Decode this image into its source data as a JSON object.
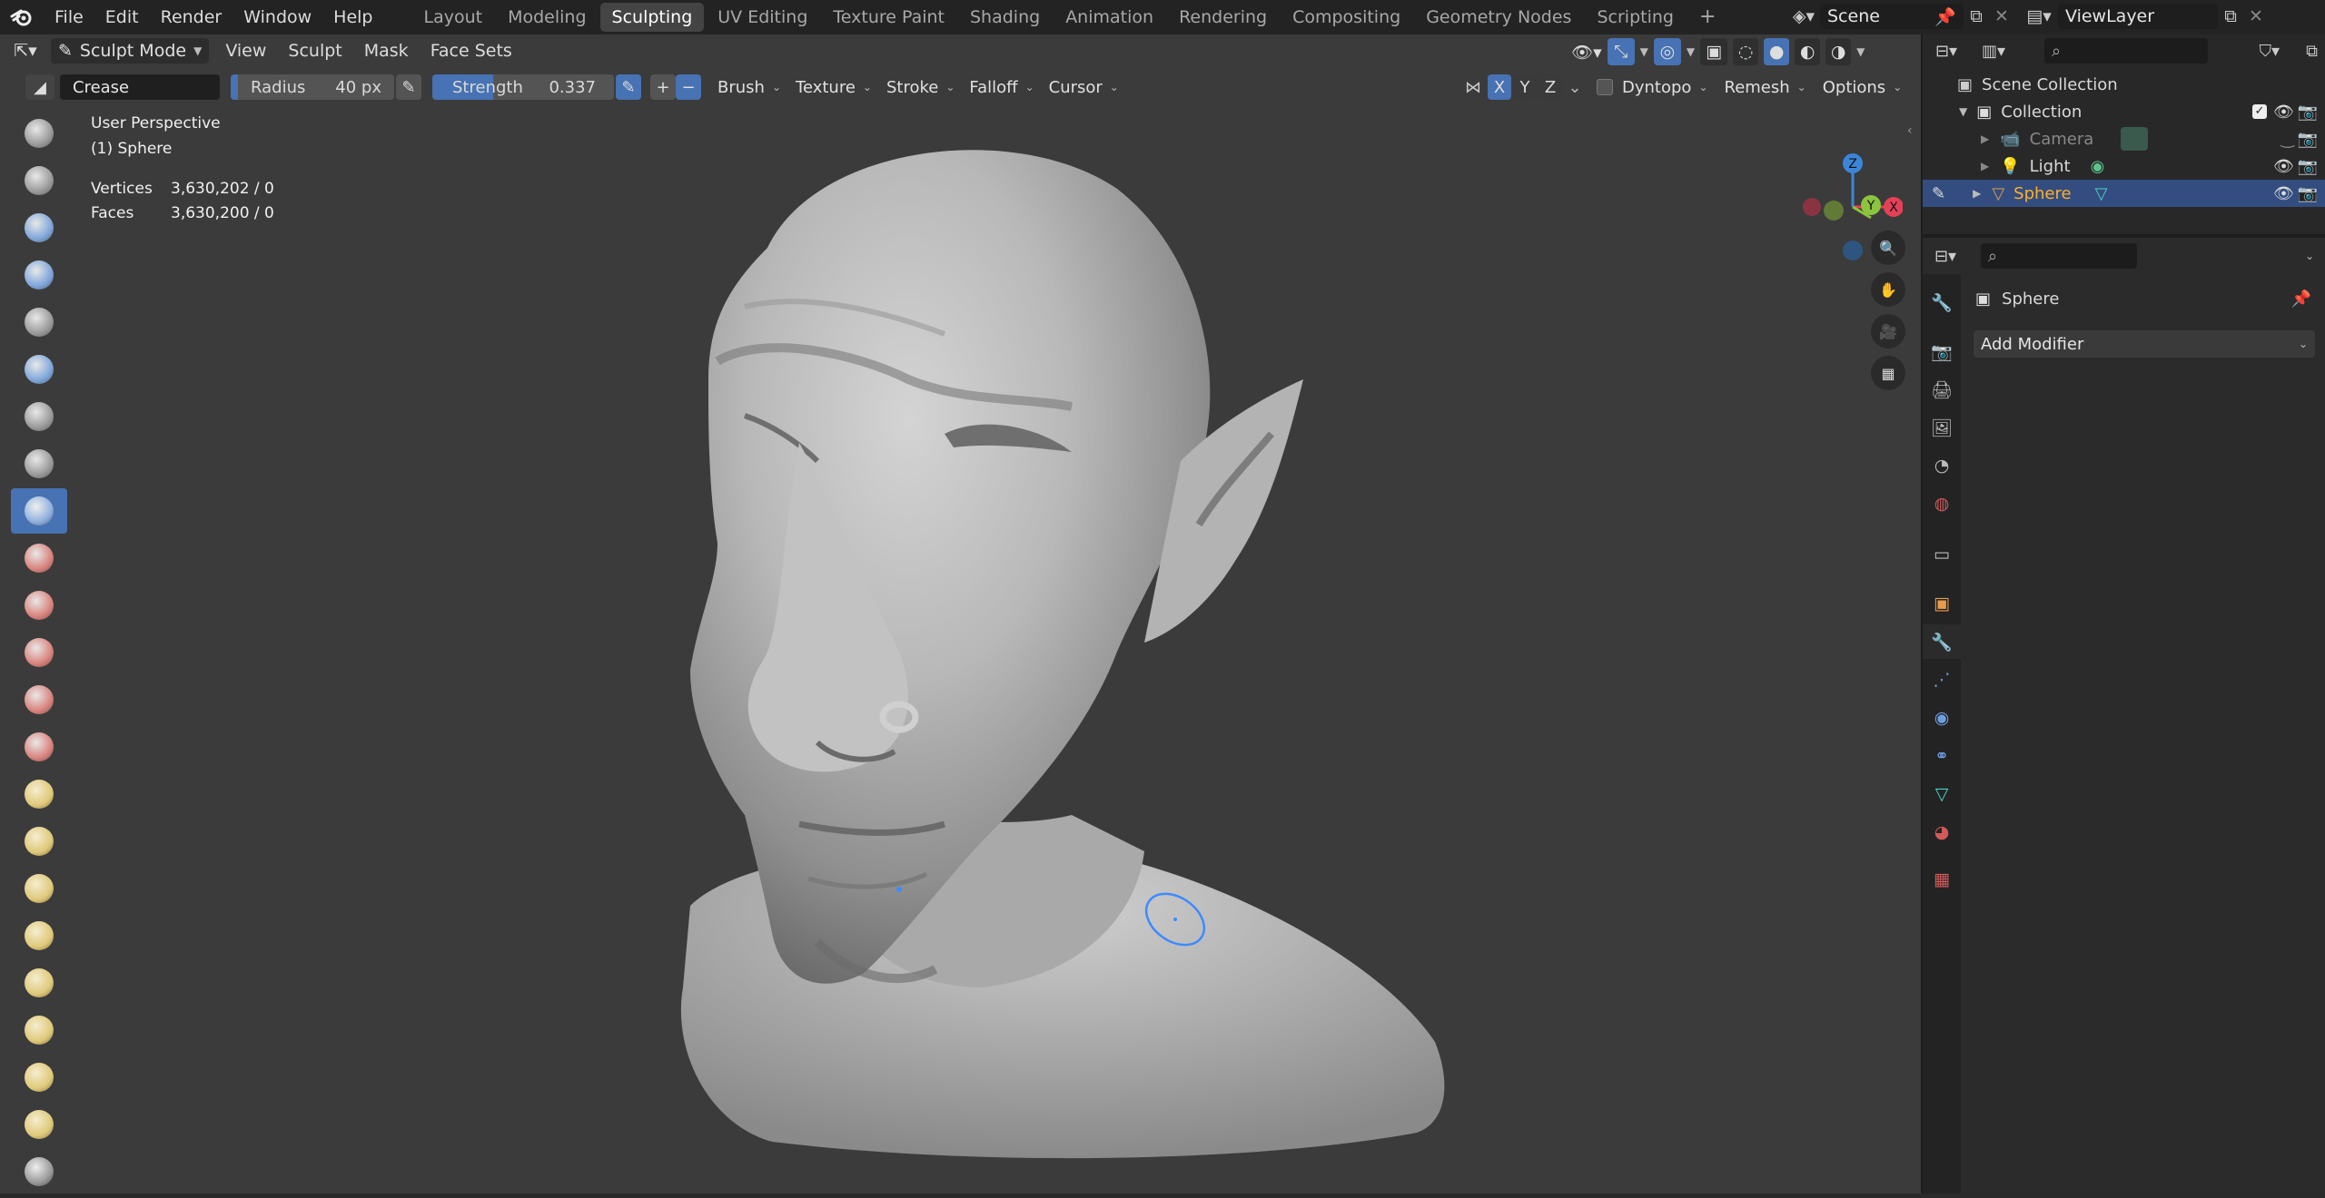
{
  "menubar": {
    "items": [
      "File",
      "Edit",
      "Render",
      "Window",
      "Help"
    ],
    "workspaces": [
      "Layout",
      "Modeling",
      "Sculpting",
      "UV Editing",
      "Texture Paint",
      "Shading",
      "Animation",
      "Rendering",
      "Compositing",
      "Geometry Nodes",
      "Scripting"
    ],
    "active_workspace": "Sculpting",
    "add_workspace": "+",
    "scene": "Scene",
    "view_layer": "ViewLayer"
  },
  "viewport_header": {
    "mode": "Sculpt Mode",
    "menus": [
      "View",
      "Sculpt",
      "Mask",
      "Face Sets"
    ]
  },
  "tool_settings": {
    "brush_name": "Crease",
    "radius_label": "Radius",
    "radius_value": "40 px",
    "strength_label": "Strength",
    "strength_value": "0.337",
    "strength_fraction": 0.337,
    "add_sub": [
      "+",
      "−"
    ],
    "dropdowns": [
      "Brush",
      "Texture",
      "Stroke",
      "Falloff",
      "Cursor"
    ],
    "symmetry": [
      "X",
      "Y",
      "Z"
    ],
    "dyntopo": "Dyntopo",
    "remesh": "Remesh",
    "options": "Options"
  },
  "overlay_info": {
    "perspective": "User Perspective",
    "object": "(1) Sphere",
    "vertices_label": "Vertices",
    "vertices_value": "3,630,202 / 0",
    "faces_label": "Faces",
    "faces_value": "3,630,200 / 0"
  },
  "gizmo": {
    "z": "Z",
    "y": "Y",
    "x": "X"
  },
  "outliner": {
    "rows": [
      {
        "label": "Scene Collection"
      },
      {
        "label": "Collection"
      },
      {
        "label": "Camera"
      },
      {
        "label": "Light"
      },
      {
        "label": "Sphere"
      }
    ]
  },
  "properties": {
    "object_name": "Sphere",
    "add_modifier": "Add Modifier"
  },
  "colors": {
    "accent": "#4772b3",
    "selected_row": "#334d80",
    "active_object": "#ffaf29",
    "axis_x": "#e44057",
    "axis_y": "#8bc43e",
    "axis_z": "#3c86d9",
    "cursor_ring": "#3d8bff"
  }
}
